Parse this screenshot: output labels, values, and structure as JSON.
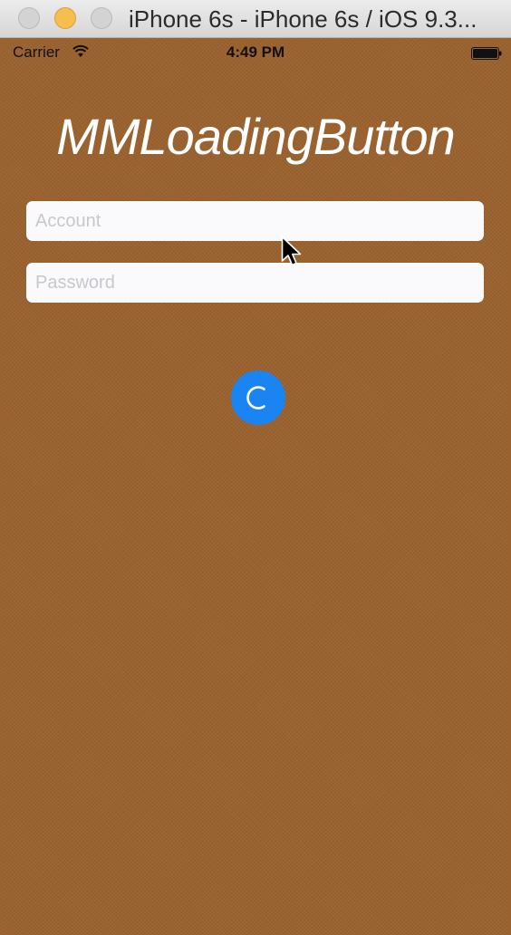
{
  "window": {
    "title": "iPhone 6s - iPhone 6s / iOS 9.3..."
  },
  "statusbar": {
    "carrier": "Carrier",
    "time": "4:49 PM"
  },
  "app": {
    "title": "MMLoadingButton",
    "account_placeholder": "Account",
    "password_placeholder": "Password"
  },
  "colors": {
    "background": "#9a622f",
    "button": "#1a84f3",
    "field": "#fafafc"
  },
  "icons": {
    "wifi": "wifi-icon",
    "battery": "battery-icon",
    "spinner": "spinner-icon",
    "cursor": "cursor-icon"
  }
}
